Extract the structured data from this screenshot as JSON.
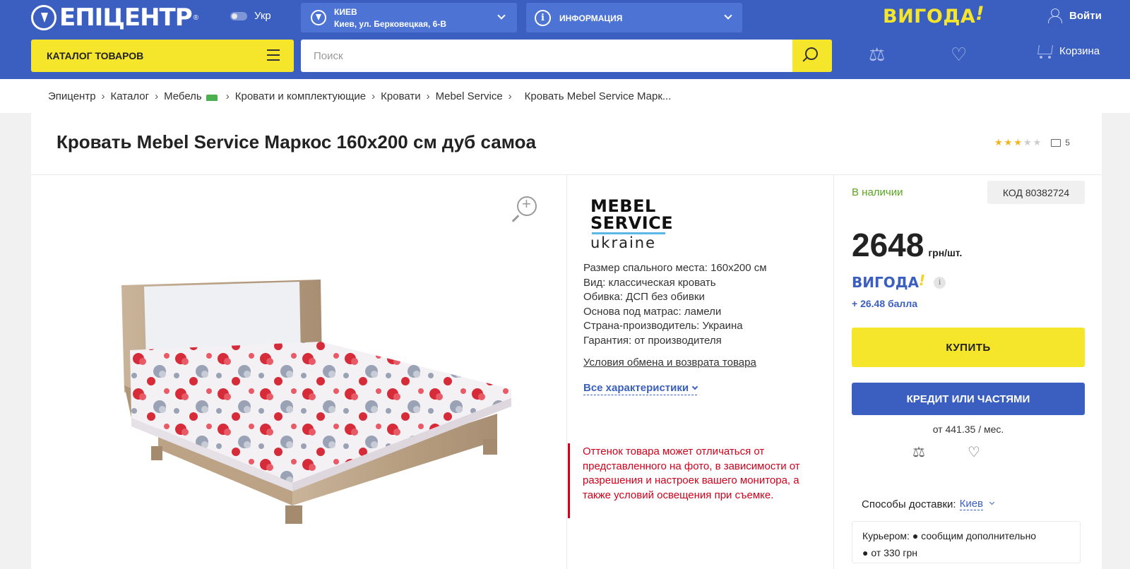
{
  "header": {
    "logo_text": "ЕПІЦЕНТР",
    "lang_label": "Укр",
    "city": {
      "name": "КИЕВ",
      "address": "Киев, ул. Берковецкая, 6-В"
    },
    "info_label": "ИНФОРМАЦИЯ",
    "promo_logo": "ВИГОДА",
    "login_label": "Войти",
    "catalog_label": "КАТАЛОГ ТОВАРОВ",
    "search_placeholder": "Поиск",
    "cart_label": "Корзина"
  },
  "breadcrumbs": [
    "Эпицентр",
    "Каталог",
    "Мебель",
    "Кровати и комплектующие",
    "Кровати",
    "Mebel Service",
    "Кровать Mebel Service Марк..."
  ],
  "product": {
    "title": "Кровать Mebel Service Маркос 160x200 см дуб самоа",
    "rating_stars": 3,
    "rating_max": 5,
    "reviews_count": "5",
    "brand": {
      "line1": "MEBEL",
      "line2": "SERVICE",
      "line3": "ukraine"
    },
    "specs": [
      "Размер спального места: 160x200 см",
      "Вид: классическая кровать",
      "Обивка: ДСП без обивки",
      "Основа под матрас: ламели",
      "Страна-производитель: Украина",
      "Гарантия: от производителя"
    ],
    "returns_link": "Условия обмена и возврата товара",
    "all_specs_link": "Все характеристики",
    "note": "Оттенок товара может отличаться от представленного на фото, в зависимости от разрешения и настроек вашего монитора, а также условий освещения при съемке.",
    "availability": "В наличии",
    "code": "КОД 80382724",
    "price": "2648",
    "price_unit": "грн/шт.",
    "bonus_logo": "ВИГОДА",
    "bonus": "+ 26.48 балла",
    "buy_label": "КУПИТЬ",
    "credit_label": "КРЕДИТ ИЛИ ЧАСТЯМИ",
    "monthly": "от 441.35 / мес.",
    "delivery_label": "Способы доставки:",
    "delivery_city": "Киев",
    "courier_line1": "Курьером: ● сообщим дополнительно",
    "courier_line2": "● от 330 грн"
  },
  "colors": {
    "header_blue": "#3b5fc0",
    "accent_yellow": "#f5e52b",
    "stock_green": "#5aa51f",
    "note_red": "#d0021b"
  },
  "icons": [
    "logo-mark-icon",
    "toggle-icon",
    "location-icon",
    "info-icon",
    "user-icon",
    "menu-icon",
    "search-icon",
    "compare-icon",
    "heart-icon",
    "cart-icon",
    "star-icon",
    "comment-icon",
    "zoom-icon",
    "chevron-down-icon"
  ]
}
